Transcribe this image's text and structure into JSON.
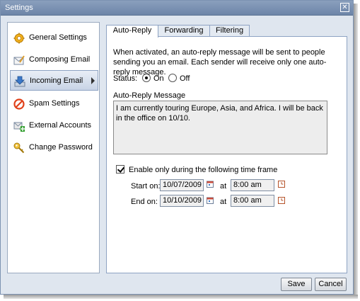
{
  "window": {
    "title": "Settings",
    "close_glyph": "✕"
  },
  "sidebar": {
    "items": [
      {
        "label": "General Settings",
        "icon": "gear-icon"
      },
      {
        "label": "Composing Email",
        "icon": "compose-icon"
      },
      {
        "label": "Incoming Email",
        "icon": "inbox-down-arrow-icon",
        "active": true
      },
      {
        "label": "Spam Settings",
        "icon": "no-entry-icon"
      },
      {
        "label": "External Accounts",
        "icon": "add-account-icon"
      },
      {
        "label": "Change Password",
        "icon": "key-icon"
      }
    ]
  },
  "tabs": [
    {
      "label": "Auto-Reply",
      "active": true
    },
    {
      "label": "Forwarding"
    },
    {
      "label": "Filtering"
    }
  ],
  "auto_reply": {
    "description": "When activated, an auto-reply message will be sent to people sending you an email. Each sender will receive only one auto-reply message.",
    "status_label": "Status:",
    "status_on_label": "On",
    "status_off_label": "Off",
    "status_value": "On",
    "message_label": "Auto-Reply Message",
    "message_text": "I am currently touring Europe, Asia, and Africa. I will be back in the office on 10/10.",
    "timeframe_label": "Enable only during the following time frame",
    "timeframe_enabled": true,
    "start_label": "Start on:",
    "start_date": "10/07/2009",
    "start_at_label": "at",
    "start_time": "8:00 am",
    "end_label": "End on:",
    "end_date": "10/10/2009",
    "end_at_label": "at",
    "end_time": "8:00 am"
  },
  "footer": {
    "save_label": "Save",
    "cancel_label": "Cancel"
  },
  "colors": {
    "titlebar": "#7b91b1",
    "panel_bg": "#dfe6ef",
    "accent_border": "#8ea3c3"
  }
}
